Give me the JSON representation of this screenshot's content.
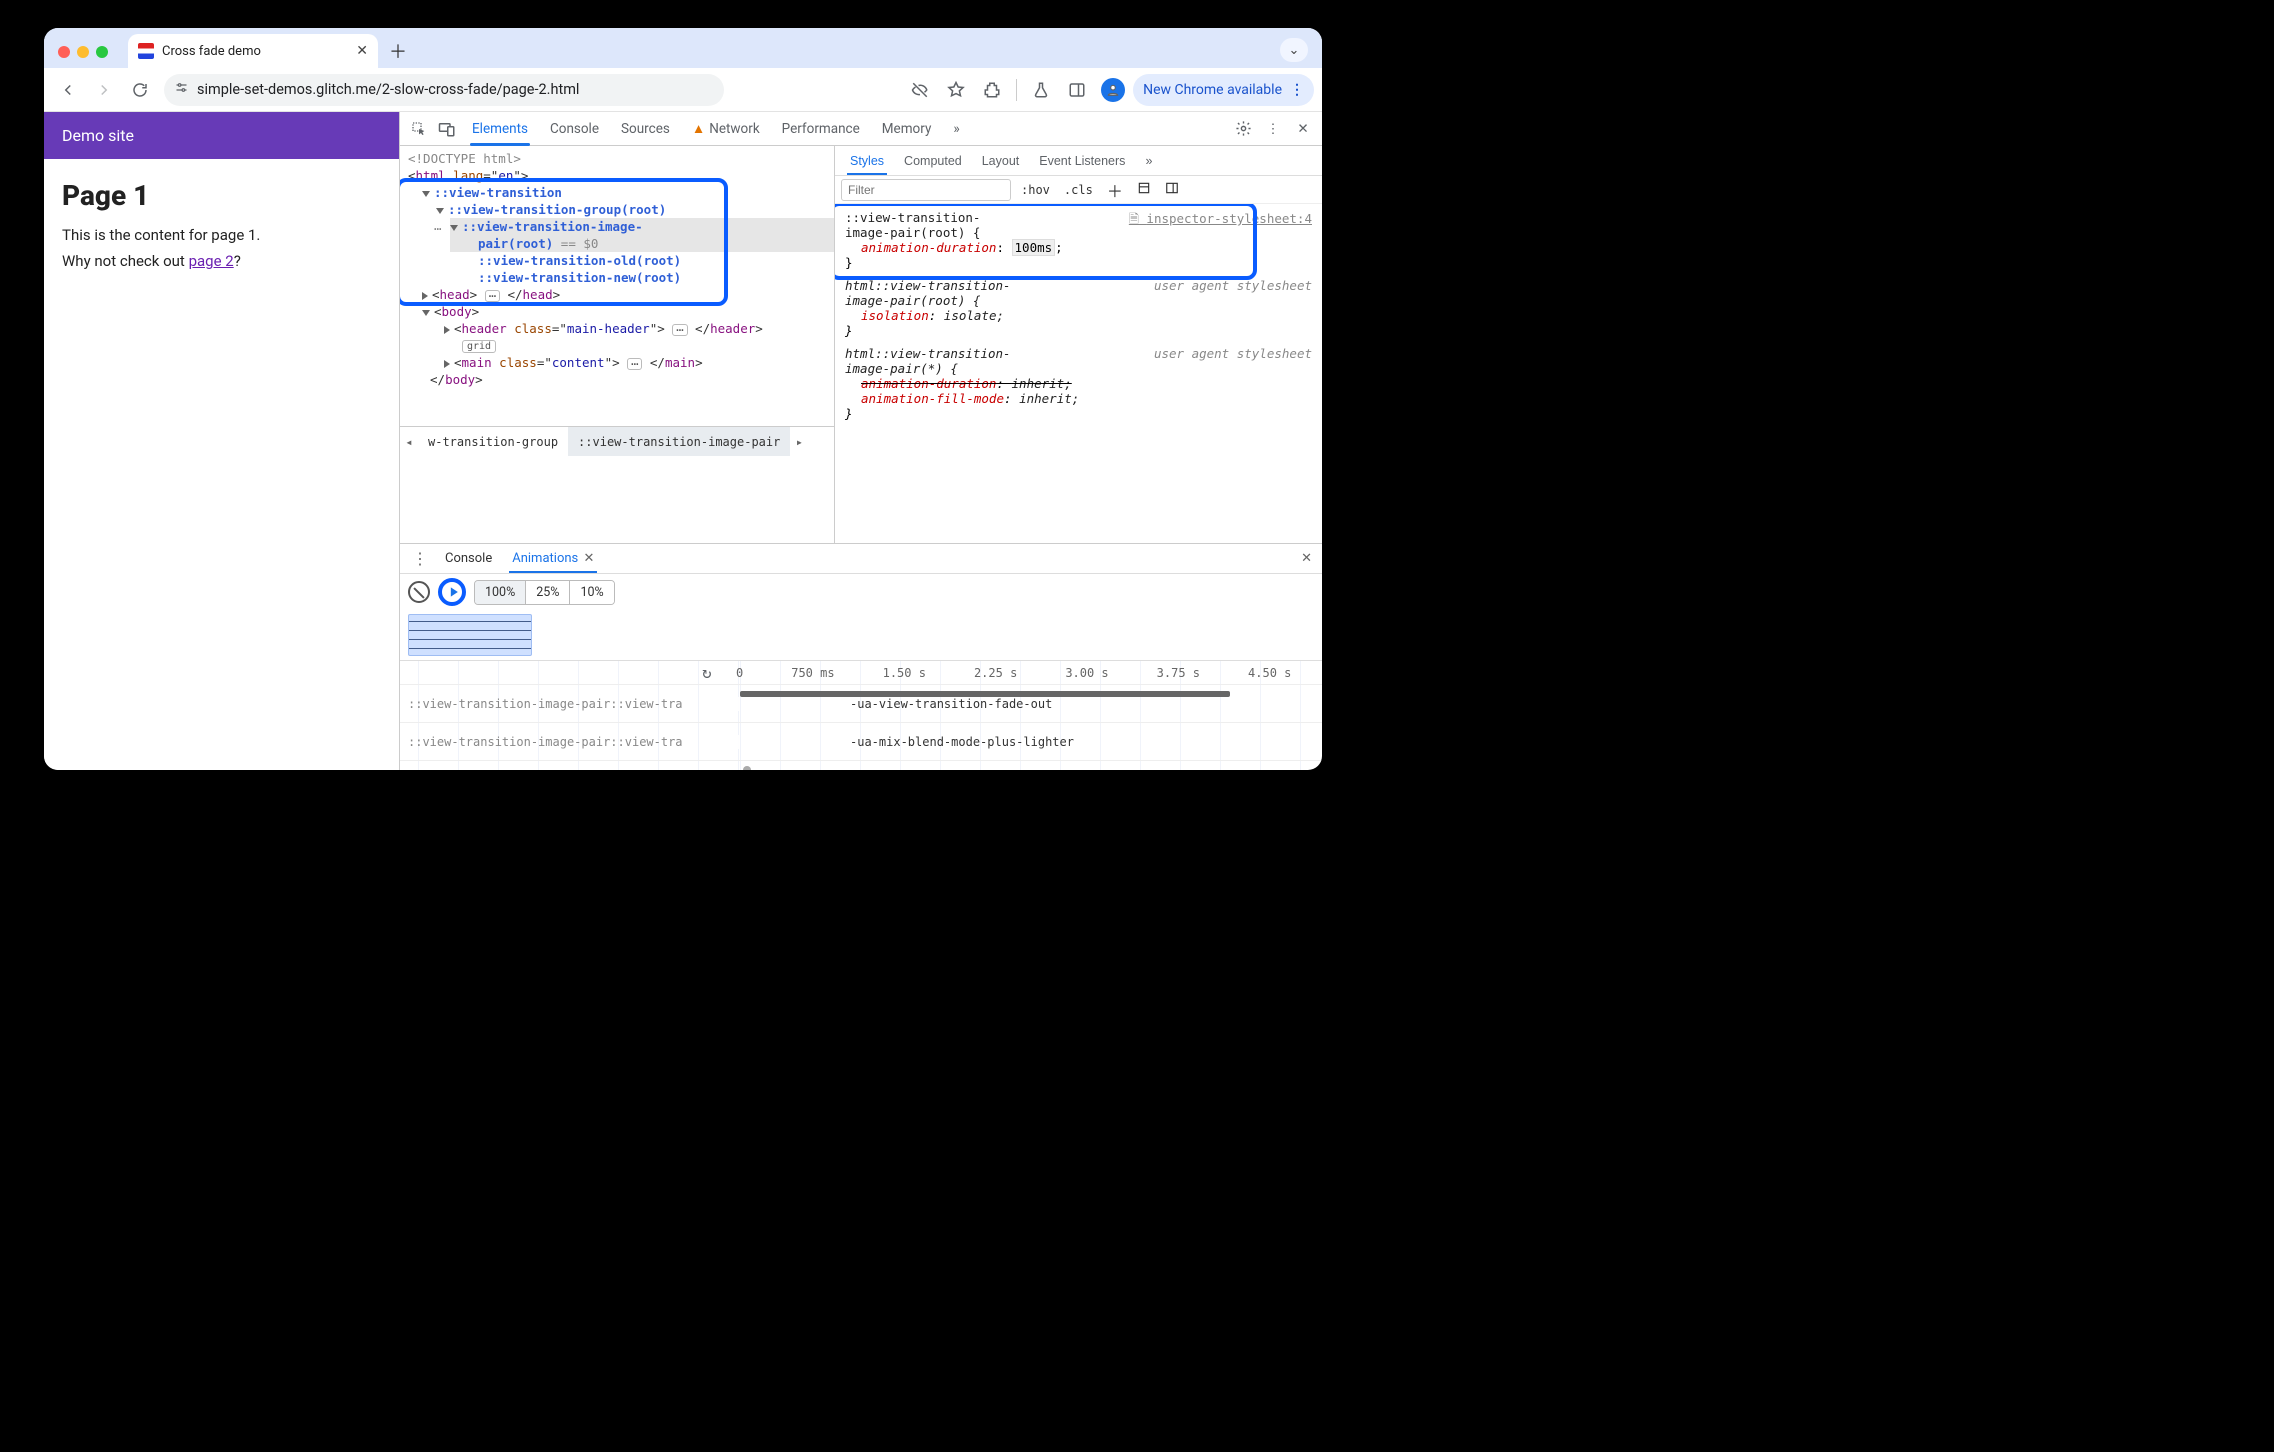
{
  "browser": {
    "tab_title": "Cross fade demo",
    "url": "simple-set-demos.glitch.me/2-slow-cross-fade/page-2.html",
    "update_pill": "New Chrome available"
  },
  "page": {
    "site_title": "Demo site",
    "h1": "Page 1",
    "p1": "This is the content for page 1.",
    "p2_pre": "Why not check out ",
    "p2_link": "page 2",
    "p2_post": "?"
  },
  "devtools": {
    "tabs": [
      "Elements",
      "Console",
      "Sources",
      "Network",
      "Performance",
      "Memory"
    ],
    "more": "»",
    "styles_tabs": [
      "Styles",
      "Computed",
      "Layout",
      "Event Listeners"
    ],
    "styles_more": "»",
    "filter_placeholder": "Filter",
    "hov": ":hov",
    "cls": ".cls",
    "elements": {
      "doctype": "<!DOCTYPE html>",
      "html_open": "<html lang=\"en\">",
      "vt": "::view-transition",
      "vtg": "::view-transition-group(root)",
      "vtip_a": "::view-transition-image-",
      "vtip_b": "pair(root)",
      "eq0": " == $0",
      "vtold": "::view-transition-old(root)",
      "vtnew": "::view-transition-new(root)",
      "head_open": "<head>",
      "head_close": "</head>",
      "body_open": "<body>",
      "header_open": "<header class=\"main-header\">",
      "header_close": "</header>",
      "grid_badge": "grid",
      "main_open": "<main class=\"content\">",
      "main_close": "</main>",
      "body_close": "</body>",
      "crumb1": "w-transition-group",
      "crumb2": "::view-transition-image-pair"
    },
    "styles": {
      "rule1_sel": "::view-transition-image-pair(root) {",
      "rule1_src": "inspector-stylesheet:4",
      "rule1_prop": "animation-duration",
      "rule1_val": "100ms",
      "rule1_end": "}",
      "rule2_sel": "html::view-transition-image-pair(root) {",
      "rule2_ua": "user agent stylesheet",
      "rule2_prop": "isolation",
      "rule2_val": "isolate;",
      "rule2_end": "}",
      "rule3_sel": "html::view-transition-image-pair(*) {",
      "rule3_ua": "user agent stylesheet",
      "rule3_p1": "animation-duration",
      "rule3_v1": "inherit;",
      "rule3_p2": "animation-fill-mode",
      "rule3_v2": "inherit;",
      "rule3_end": "}"
    },
    "drawer": {
      "tabs": [
        "Console",
        "Animations"
      ],
      "speeds": [
        "100%",
        "25%",
        "10%"
      ],
      "ticks": [
        "0",
        "750 ms",
        "1.50 s",
        "2.25 s",
        "3.00 s",
        "3.75 s",
        "4.50 s"
      ],
      "row1_label": "::view-transition-image-pair::view-tra",
      "row1_anim": "-ua-view-transition-fade-out",
      "row2_label": "::view-transition-image-pair::view-tra",
      "row2_anim": "-ua-mix-blend-mode-plus-lighter"
    }
  }
}
